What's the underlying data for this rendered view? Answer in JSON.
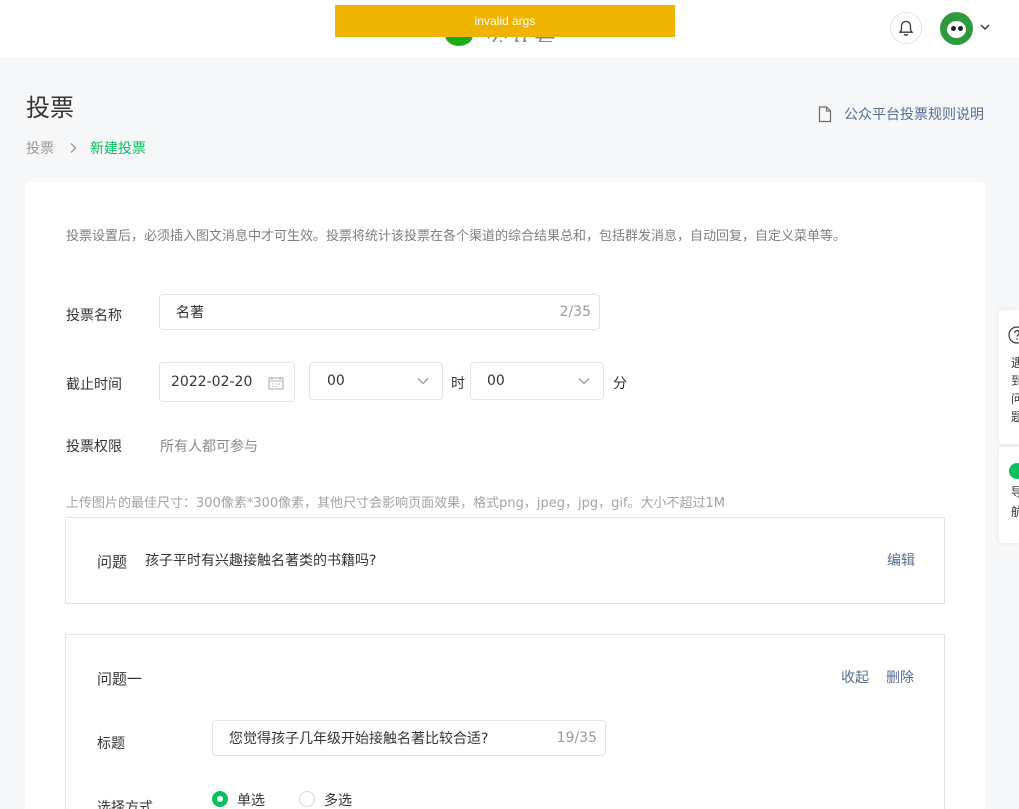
{
  "topbar": {
    "banner_text": "invalid args",
    "logo_text": "公众号",
    "bell_icon": "bell-icon",
    "avatar_text": "",
    "brand_color": "#07c160",
    "banner_color": "#eeb400"
  },
  "page": {
    "title": "投票",
    "rules_link": "公众平台投票规则说明",
    "breadcrumb": [
      "投票",
      "新建投票"
    ]
  },
  "form": {
    "notice": "投票设置后，必须插入图文消息中才可生效。投票将统计该投票在各个渠道的综合结果总和，包括群发消息，自动回复，自定义菜单等。",
    "name_label": "投票名称",
    "name_value": "名著",
    "name_counter": "2/35",
    "deadline_label": "截止时间",
    "date_value": "2022-02-20",
    "hour_value": "00",
    "hour_unit": "时",
    "minute_value": "00",
    "minute_unit": "分",
    "permission_label": "投票权限",
    "permission_value": "所有人都可参与",
    "upload_hint": "上传图片的最佳尺寸：300像素*300像素，其他尺寸会影响页面效果，格式png，jpeg，jpg，gif。大小不超过1M"
  },
  "question_summary": {
    "label": "问题",
    "text": "孩子平时有兴趣接触名著类的书籍吗?",
    "edit": "编辑"
  },
  "question_one": {
    "heading": "问题一",
    "collapse": "收起",
    "delete": "删除",
    "title_label": "标题",
    "title_value": "您觉得孩子几年级开始接触名著比较合适?",
    "title_counter": "19/35",
    "mode_label": "选择方式",
    "single": "单选",
    "multiple": "多选",
    "selected_mode": "单选"
  },
  "floating": {
    "panel1": [
      "遇",
      "到",
      "问",
      "题"
    ],
    "panel2": [
      "导",
      "航"
    ]
  }
}
